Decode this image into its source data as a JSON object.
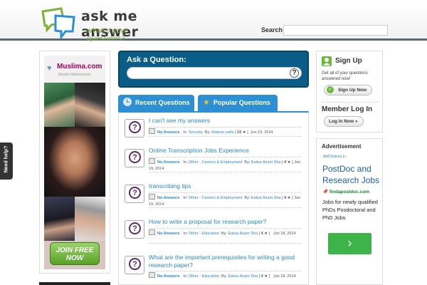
{
  "header": {
    "logo_title": "ask me answer",
    "logo_tagline": "what's your questions?",
    "search_label": "Search",
    "search_value": ""
  },
  "need_help": "Need help?",
  "left_ad": {
    "brand": "Muslima.com",
    "sub": "Muslim Matrimonials",
    "cta": "JOIN FREE NOW"
  },
  "ask": {
    "title": "Ask a Question:",
    "value": "",
    "help_icon": "question-mark-icon"
  },
  "tabs": [
    {
      "label": "Recent Questions",
      "icon": "clock-icon"
    },
    {
      "label": "Popular Questions",
      "icon": "star-icon"
    }
  ],
  "questions": [
    {
      "title": "I can't see my answers",
      "answers": "No Answers",
      "in_label": "In:",
      "category": "Security",
      "by_label": "By:",
      "author": "khairun.nafiz",
      "points": "10",
      "date": "Jun 19, 2014"
    },
    {
      "title": "Online Transcription Jobs Experience",
      "answers": "No Answers",
      "in_label": "In:",
      "category": "Other - Careers & Employment",
      "by_label": "By:",
      "author": "Ealius Azam Sha",
      "points": "4",
      "date": "Jun 19, 2014"
    },
    {
      "title": "transcribing tips",
      "answers": "No Answers",
      "in_label": "In:",
      "category": "Other - Careers & Employment",
      "by_label": "By:",
      "author": "Ealius Azam Sha",
      "points": "4",
      "date": "Jun 19, 2014"
    },
    {
      "title": "How to write a proposal for research paper?",
      "answers": "No Answers",
      "in_label": "In:",
      "category": "Other - Education",
      "by_label": "By:",
      "author": "Ealius Azam Sha",
      "points": "4",
      "date": "Jun 18, 2014"
    },
    {
      "title": "What are the important prerequisites for writing a good research paper?",
      "answers": "No Answers",
      "in_label": "In:",
      "category": "Other - Education",
      "by_label": "By:",
      "author": "Ealius Azam Sha",
      "points": "4",
      "date": "Jun 18, 2014"
    }
  ],
  "sidebar": {
    "signup_title": "Sign Up",
    "signup_desc": "Get all of your questions answered now!",
    "signup_button": "Sign Up Now",
    "login_title": "Member Log In",
    "login_button": "Log In Now »"
  },
  "advert": {
    "title": "Advertisement",
    "adchoices": "AdChoices",
    "headline": "PostDoc and Research Jobs",
    "url": "findapostdoc.com",
    "body": "Jobs for newly qualified PhDs Posdoctoral and PhD Jobs",
    "button_icon": "chevron-right-icon"
  },
  "colors": {
    "accent_blue": "#2d8fd4",
    "ask_box": "#0a5d86",
    "link": "#2a88c9",
    "brand_green": "#7fb13a"
  }
}
